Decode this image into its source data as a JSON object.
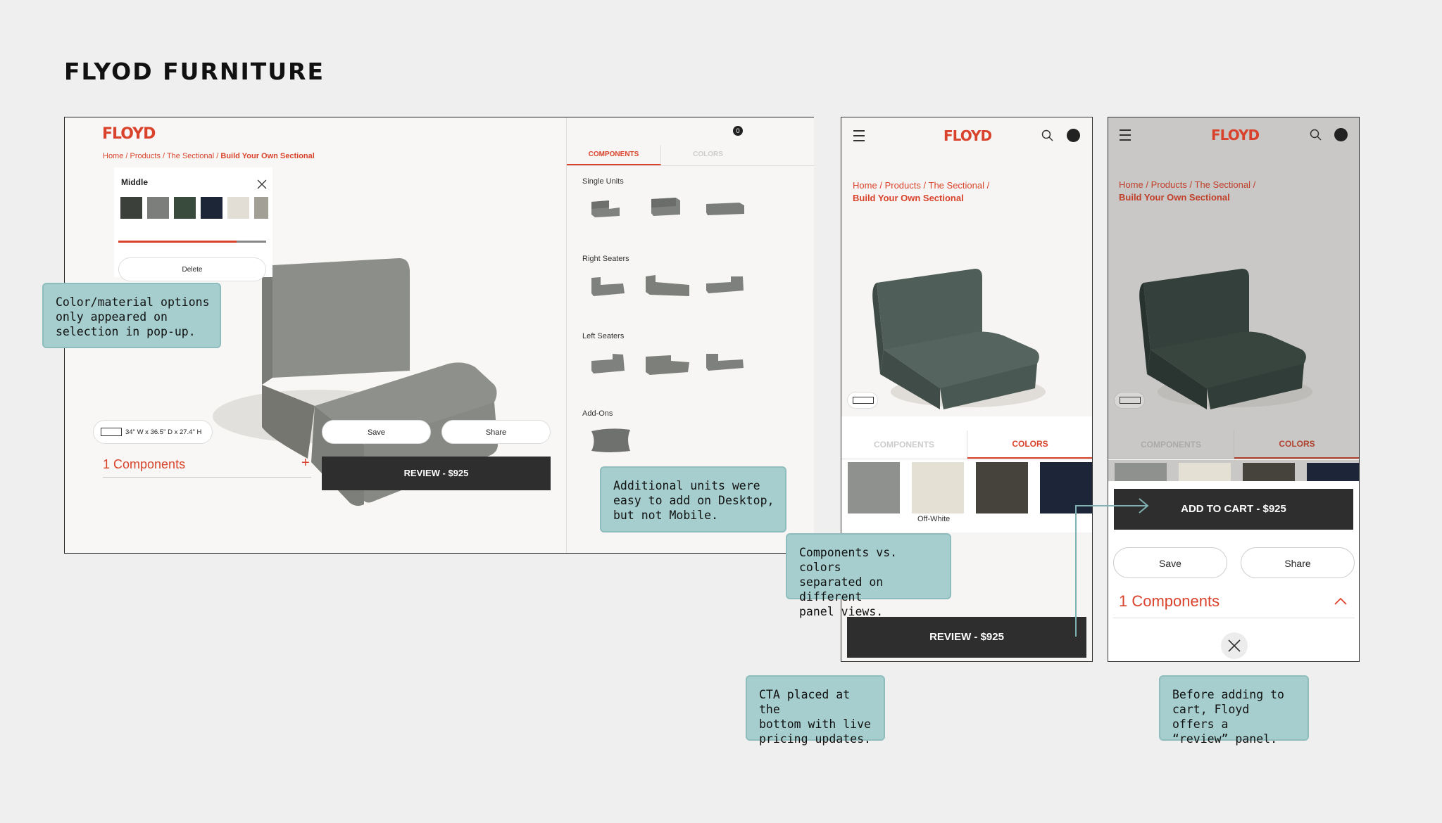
{
  "page_title": "FLYOD FURNITURE",
  "desktop": {
    "logo": "FLOYD",
    "breadcrumb": {
      "home": "Home",
      "products": "Products",
      "sectional": "The Sectional",
      "current": "Build Your Own Sectional",
      "sep": "/"
    },
    "cart_count": "0",
    "popup": {
      "title": "Middle",
      "delete_label": "Delete",
      "swatches": [
        "#3c403b",
        "#7b7e7b",
        "#394b3d",
        "#1d2637",
        "#e2ded5",
        "#a29f96"
      ],
      "progress": 0.8
    },
    "dimensions": "34\" W x 36.5\" D x 27.4\" H",
    "save_label": "Save",
    "share_label": "Share",
    "components_summary": "1 Components",
    "plus": "+",
    "review_button": "REVIEW - $925",
    "tabs": {
      "components": "COMPONENTS",
      "colors": "COLORS",
      "active": "components"
    },
    "sections": [
      "Single Units",
      "Right Seaters",
      "Left Seaters",
      "Add-Ons"
    ]
  },
  "mobile1": {
    "logo": "FLOYD",
    "breadcrumb": {
      "home": "Home",
      "products": "Products",
      "sectional": "The Sectional",
      "current": "Build Your Own Sectional",
      "sep": "/"
    },
    "tabs": {
      "components": "COMPONENTS",
      "colors": "COLORS",
      "active": "colors"
    },
    "swatches": [
      "#8f918f",
      "#e4e0d3",
      "#45433c",
      "#1c2638"
    ],
    "selected_swatch_label": "Off-White",
    "review_button": "REVIEW - $925"
  },
  "mobile2": {
    "logo": "FLOYD",
    "breadcrumb": {
      "home": "Home",
      "products": "Products",
      "sectional": "The Sectional",
      "current": "Build Your Own Sectional",
      "sep": "/"
    },
    "tabs": {
      "components": "COMPONENTS",
      "colors": "COLORS",
      "active": "colors"
    },
    "add_to_cart": "ADD TO CART - $925",
    "save_label": "Save",
    "share_label": "Share",
    "components_summary": "1 Components"
  },
  "notes": {
    "color_options": "Color/material options\nonly appeared on\nselection in pop-up.",
    "additional_units": "Additional units were\neasy to add on Desktop,\nbut not Mobile.",
    "components_vs_colors": "Components vs. colors\nseparated on different\npanel views.",
    "cta": "CTA placed at the\nbottom with live\npricing updates.",
    "review_panel": "Before adding to\ncart, Floyd offers a\n“review” panel."
  },
  "colors": {
    "brand": "#d9432c",
    "dark_button": "#2e2e2e",
    "note_bg": "#a6cece",
    "sofa_grey": "#8c8e8a",
    "sofa_green": "#46544f"
  }
}
